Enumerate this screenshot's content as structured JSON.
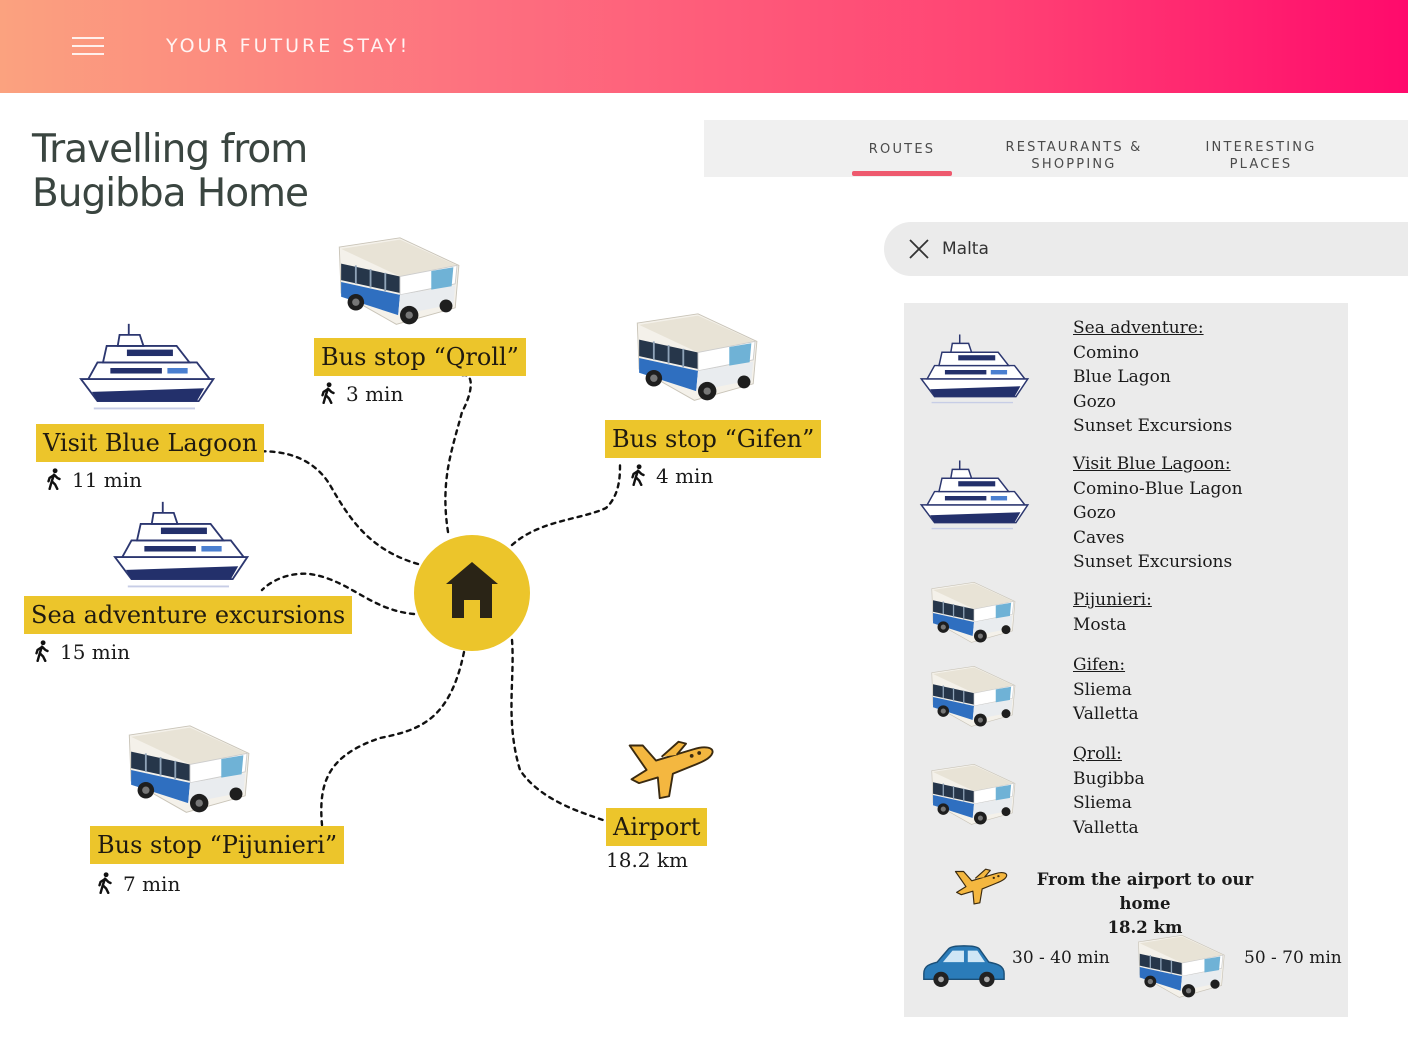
{
  "header": {
    "brand": "YOUR FUTURE STAY!"
  },
  "page": {
    "title_line1": "Travelling from",
    "title_line2": "Bugibba Home"
  },
  "tabs": {
    "routes": "ROUTES",
    "restaurants_line1": "RESTAURANTS &",
    "restaurants_line2": "SHOPPING",
    "places_line1": "INTERESTING",
    "places_line2": "PLACES",
    "active": "ROUTES"
  },
  "search": {
    "value": "Malta"
  },
  "map": {
    "qroll": {
      "label": "Bus stop “Qroll”",
      "walk": "3 min"
    },
    "gifen": {
      "label": "Bus stop “Gifen”",
      "walk": "4 min"
    },
    "blue_lagoon": {
      "label": "Visit Blue Lagoon",
      "walk": "11 min"
    },
    "sea_adventure": {
      "label": "Sea adventure excursions",
      "walk": "15 min"
    },
    "pijunieri": {
      "label": "Bus stop “Pijunieri”",
      "walk": "7 min"
    },
    "airport": {
      "label": "Airport",
      "distance": "18.2 km"
    }
  },
  "panel": {
    "sea_adventure": {
      "head": "Sea adventure:",
      "items": [
        "Comino",
        "Blue Lagon",
        "Gozo",
        "Sunset Excursions"
      ]
    },
    "blue_lagoon": {
      "head": "Visit Blue Lagoon:",
      "items": [
        "Comino-Blue Lagon",
        "Gozo",
        "Caves",
        "Sunset Excursions"
      ]
    },
    "pijunieri": {
      "head": "Pijunieri:",
      "items": [
        "Mosta"
      ]
    },
    "gifen": {
      "head": "Gifen:",
      "items": [
        "Sliema",
        "Valletta"
      ]
    },
    "qroll": {
      "head": "Qroll:",
      "items": [
        "Bugibba",
        "Sliema",
        "Valletta"
      ]
    },
    "airport_line1": "From the airport to our home",
    "airport_line2": "18.2 km",
    "car_time": "30 - 40 min",
    "bus_time": "50 - 70 min"
  },
  "colors": {
    "label_bg": "#ecc52b",
    "tab_underline": "#ee5a6e",
    "panel_bg": "#ebebeb"
  }
}
